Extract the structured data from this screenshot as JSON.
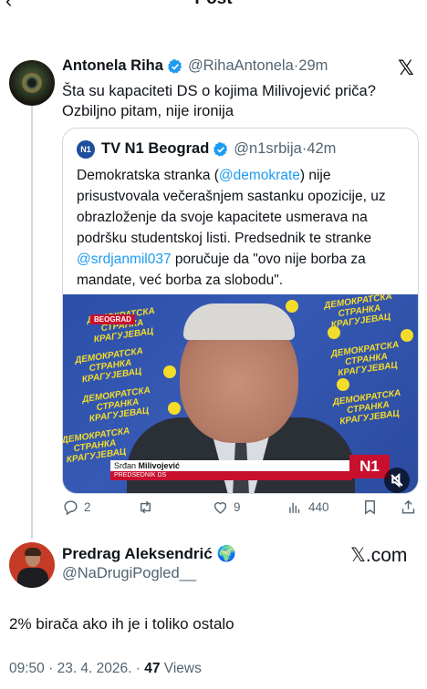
{
  "header": {
    "back_glyph": "‹",
    "title": "Post"
  },
  "tweet": {
    "author_name": "Antonela Riha",
    "handle": "@RihaAntonela",
    "separator": "·",
    "time": "29m",
    "text_line1": "Šta su kapaciteti DS o kojima Milivojević priča?",
    "text_line2": "Ozbiljno pitam, nije ironija",
    "close_glyph": "𝕏"
  },
  "quote": {
    "author_name": "TV N1 Beograd",
    "badge_text": "N1",
    "handle": "@n1srbija",
    "separator": "·",
    "time": "42m",
    "text_a": "Demokratska stranka (",
    "mention1": "@demokrate",
    "text_b": ") nije prisustvovala večerašnjem sastanku opozicije, uz obrazloženje da svoje kapacitete usmerava na podršku studentskoj listi. Predsednik te stranke ",
    "mention2": "@srdjanmil037",
    "text_c": " poručuje da \"ovo nije borba za mandate, već borba za slobodu\".",
    "media": {
      "location_tag": "BEOGRAD",
      "wall_text": "ДЕМОКРАТСКА СТРАНКА КРАГУЈЕВАЦ",
      "caption_first": "Srđan",
      "caption_last": "Milivojević",
      "caption_role": "PREDSEDNIK DS",
      "logo": "N1",
      "mute_icon": "speaker-muted-icon"
    }
  },
  "actions": {
    "replies": "2",
    "retweets": "",
    "likes": "9",
    "views": "440"
  },
  "reply": {
    "author_name": "Predrag Aleksendrić",
    "globe_emoji": "🌍",
    "handle": "@NaDrugiPogled__",
    "source_label": "𝕏.com",
    "text": "2% birača ako ih je i toliko ostalo"
  },
  "meta": {
    "time": "09:50",
    "sep1": " · ",
    "date": "23. 4. 2026.",
    "sep2": " · ",
    "views_count": "47",
    "views_label": " Views"
  },
  "colors": {
    "text": "#0f1419",
    "secondary": "#536471",
    "link": "#1d9bf0",
    "verified": "#1d9bf0",
    "border": "#cfd9de",
    "n1_red": "#c8102e",
    "wall_blue": "#2b4fa8",
    "wall_yellow": "#f4dc2a"
  }
}
